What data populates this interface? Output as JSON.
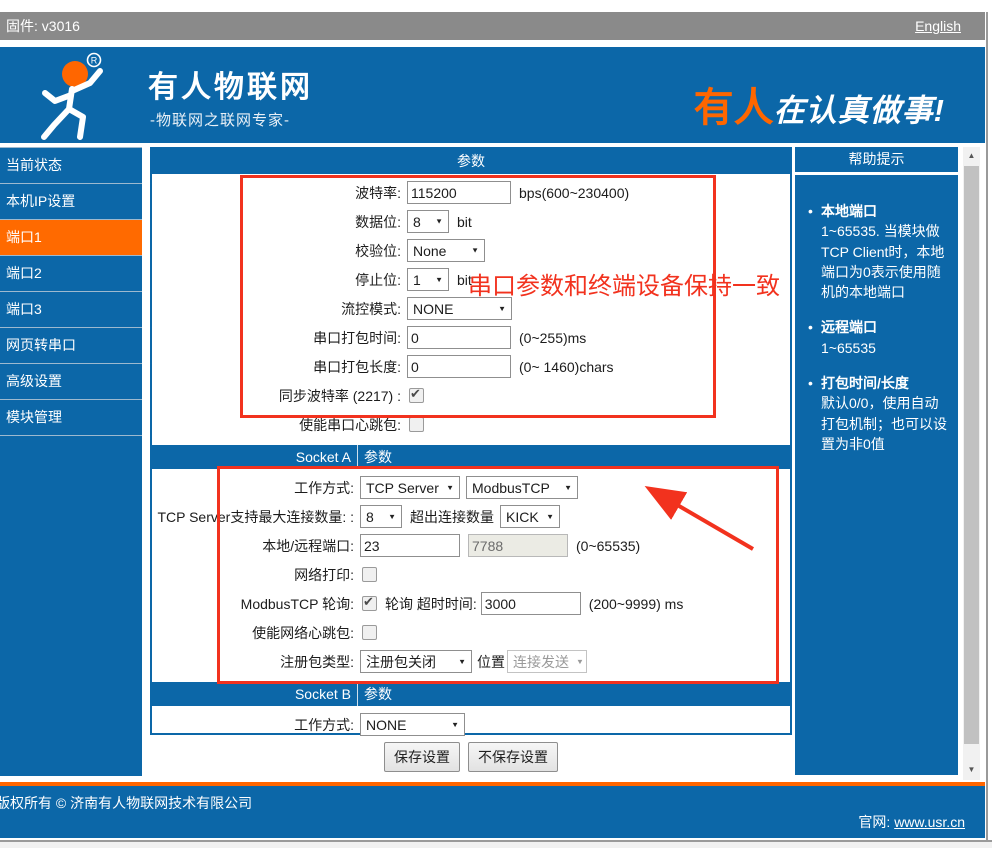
{
  "topbar": {
    "firmware": "固件: v3016",
    "lang_link": "English"
  },
  "brand": {
    "title": "有人物联网",
    "subtitle": "-物联网之联网专家-",
    "slogan_orange": "有人",
    "slogan_white": "在认真做事!"
  },
  "sidebar": {
    "items": [
      {
        "label": "当前状态",
        "active": false
      },
      {
        "label": "本机IP设置",
        "active": false
      },
      {
        "label": "端口1",
        "active": true
      },
      {
        "label": "端口2",
        "active": false
      },
      {
        "label": "端口3",
        "active": false
      },
      {
        "label": "网页转串口",
        "active": false
      },
      {
        "label": "高级设置",
        "active": false
      },
      {
        "label": "模块管理",
        "active": false
      }
    ]
  },
  "main": {
    "params_header": "参数",
    "serial": {
      "baud": {
        "label": "波特率:",
        "value": "115200",
        "suffix": "bps(600~230400)"
      },
      "databits": {
        "label": "数据位:",
        "value": "8",
        "suffix": "bit"
      },
      "parity": {
        "label": "校验位:",
        "value": "None"
      },
      "stopbits": {
        "label": "停止位:",
        "value": "1",
        "suffix": "bit"
      },
      "flowctrl": {
        "label": "流控模式:",
        "value": "NONE"
      },
      "packtime": {
        "label": "串口打包时间:",
        "value": "0",
        "suffix": "(0~255)ms"
      },
      "packlen": {
        "label": "串口打包长度:",
        "value": "0",
        "suffix": "(0~ 1460)chars"
      },
      "syncbaud": {
        "label": "同步波特率 (2217) :",
        "checked": true
      },
      "heartbeat": {
        "label": "使能串口心跳包:",
        "checked": false
      }
    },
    "socket_a": {
      "header_left": "Socket A",
      "header_right": "参数",
      "workmode": {
        "label": "工作方式:",
        "value1": "TCP Server",
        "value2": "ModbusTCP"
      },
      "maxconn": {
        "label": "TCP Server支持最大连接数量: :",
        "value1": "8",
        "mid": "超出连接数量",
        "value2": "KICK"
      },
      "ports": {
        "label": "本地/远程端口:",
        "local": "23",
        "remote": "7788",
        "suffix": "(0~65535)"
      },
      "netprint": {
        "label": "网络打印:",
        "checked": false
      },
      "modbuspoll": {
        "label": "ModbusTCP 轮询:",
        "checked": true,
        "mid": "轮询 超时时间:",
        "value": "3000",
        "suffix": "(200~9999) ms"
      },
      "netheartbeat": {
        "label": "使能网络心跳包:",
        "checked": false
      },
      "regpacket": {
        "label": "注册包类型:",
        "value1": "注册包关闭",
        "mid": "位置",
        "value2": "连接发送"
      }
    },
    "socket_b": {
      "header_left": "Socket B",
      "header_right": "参数",
      "workmode": {
        "label": "工作方式:",
        "value": "NONE"
      }
    },
    "buttons": {
      "save": "保存设置",
      "cancel": "不保存设置"
    }
  },
  "help": {
    "title": "帮助提示",
    "items": [
      {
        "title": "本地端口",
        "body": "1~65535. 当模块做TCP Client时，本地端口为0表示使用随机的本地端口"
      },
      {
        "title": "远程端口",
        "body": "1~65535"
      },
      {
        "title": "打包时间/长度",
        "body": "默认0/0，使用自动打包机制；也可以设置为非0值"
      }
    ]
  },
  "annotations": {
    "note": "串口参数和终端设备保持一致"
  },
  "footer": {
    "copyright": "版权所有 © 济南有人物联网技术有限公司",
    "site_label": "官网:",
    "site_link": "www.usr.cn"
  },
  "colors": {
    "primary_blue": "#0C67A8",
    "accent_orange": "#FF6600",
    "annotation_red": "#F2321E",
    "topbar_gray": "#8A8A8A"
  }
}
